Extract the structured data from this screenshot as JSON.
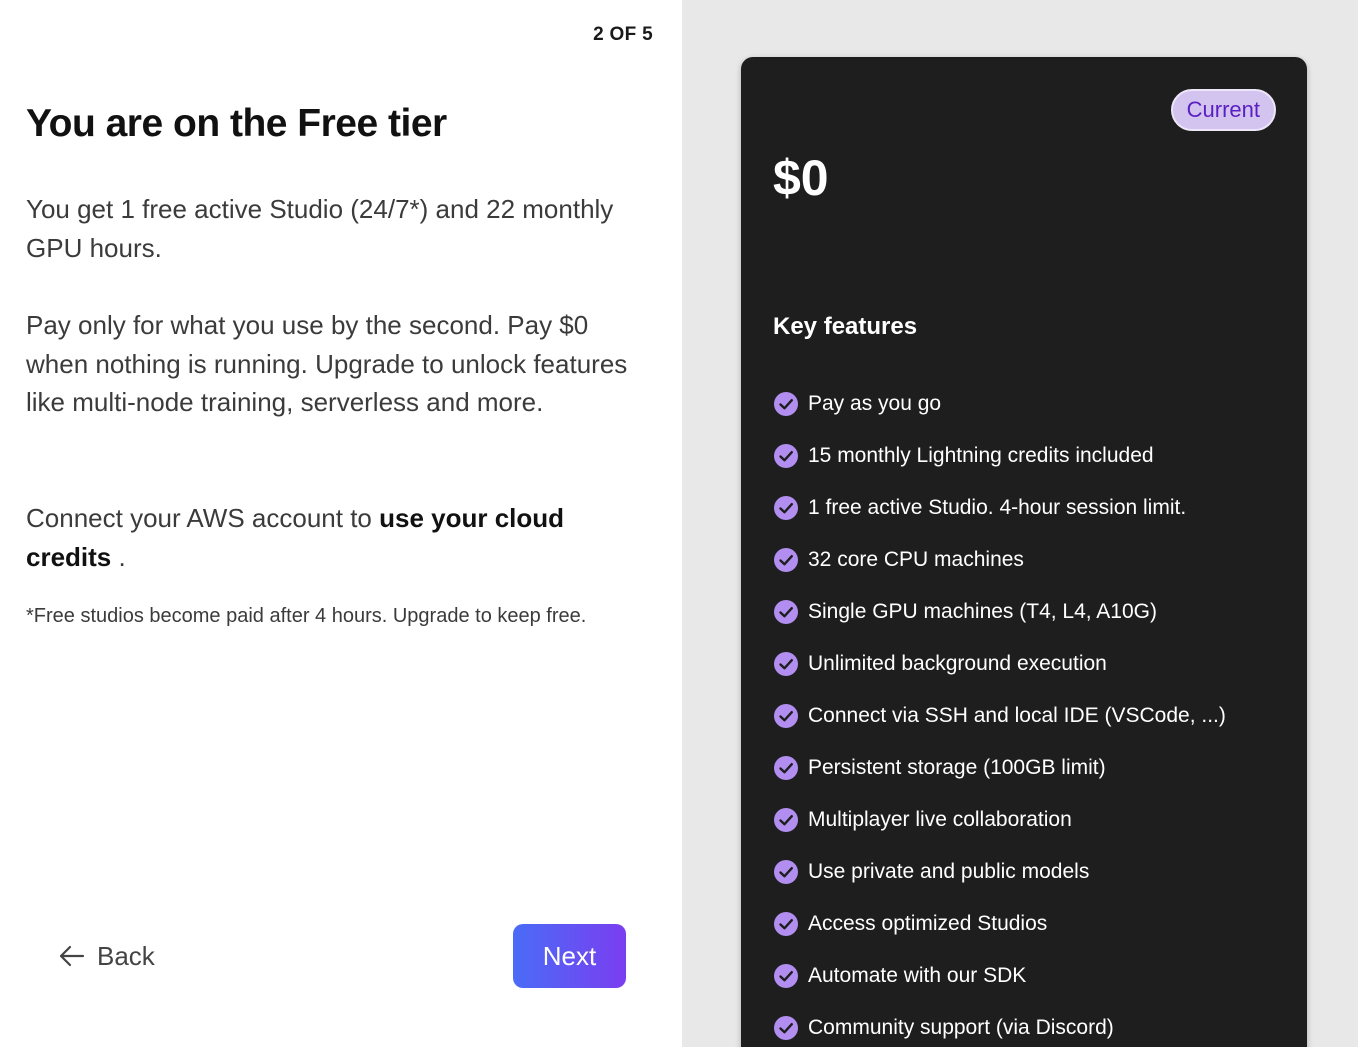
{
  "step_indicator": "2 OF 5",
  "title": "You are on the Free tier",
  "paragraphs": {
    "intro": "You get 1 free active Studio (24/7*) and 22 monthly GPU hours.",
    "pricing": "Pay only for what you use by the second. Pay $0 when nothing is running. Upgrade to unlock features like multi-node training, serverless and more.",
    "aws_prefix": "Connect your AWS account to ",
    "aws_link": "use your cloud credits",
    "aws_suffix": " ."
  },
  "footnote": "*Free studios become paid after 4 hours. Upgrade to keep free.",
  "nav": {
    "back_label": "Back",
    "next_label": "Next"
  },
  "plan": {
    "badge": "Current",
    "price": "$0",
    "features_heading": "Key features",
    "features": [
      {
        "label": "Pay as you go",
        "icon": "check-circle-icon"
      },
      {
        "label": "15 monthly Lightning credits included",
        "icon": "check-circle-icon"
      },
      {
        "label": "1 free active Studio. 4-hour session limit.",
        "icon": "check-circle-icon"
      },
      {
        "label": "32 core CPU machines",
        "icon": "check-circle-icon"
      },
      {
        "label": "Single GPU machines (T4, L4, A10G)",
        "icon": "check-circle-icon"
      },
      {
        "label": "Unlimited background execution",
        "icon": "check-circle-icon"
      },
      {
        "label": "Connect via SSH and local IDE (VSCode, ...)",
        "icon": "check-circle-icon"
      },
      {
        "label": "Persistent storage (100GB limit)",
        "icon": "check-circle-icon"
      },
      {
        "label": "Multiplayer live collaboration",
        "icon": "check-circle-icon"
      },
      {
        "label": "Use private and public models",
        "icon": "check-circle-icon"
      },
      {
        "label": "Access optimized Studios",
        "icon": "check-circle-icon"
      },
      {
        "label": "Automate with our SDK",
        "icon": "check-circle-icon"
      },
      {
        "label": "Community support (via Discord)",
        "icon": "check-circle-icon"
      }
    ]
  },
  "colors": {
    "accent_gradient_start": "#4a6cf7",
    "accent_gradient_end": "#7a3ef0",
    "card_background": "#1e1e1e",
    "check_color": "#b18ef0",
    "badge_background": "#d2c3ef",
    "badge_text": "#5a1fc2"
  }
}
